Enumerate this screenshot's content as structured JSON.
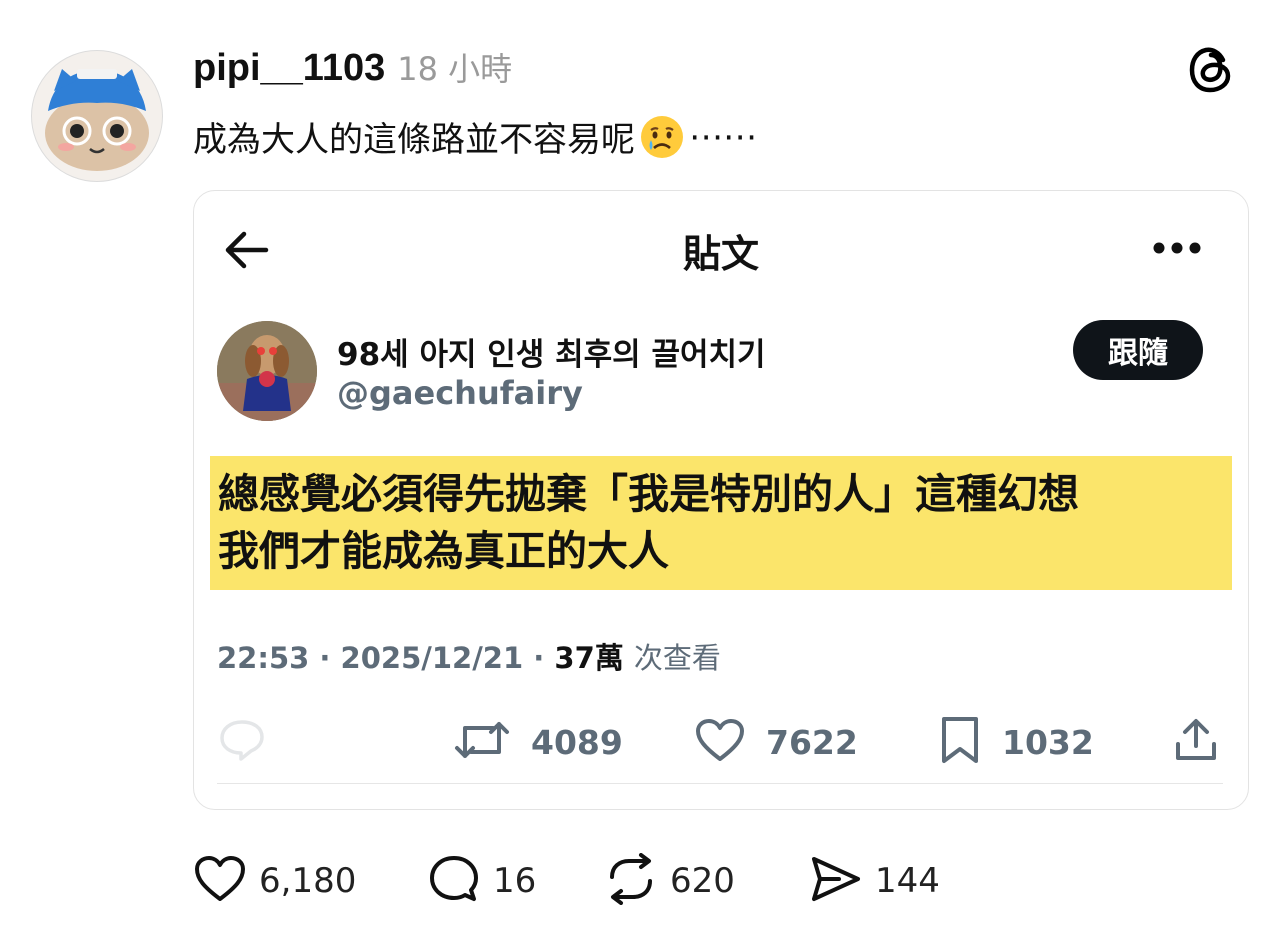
{
  "post": {
    "username": "pipi__1103",
    "time": "18 小時",
    "caption_before": "成為大人的這條路並不容易呢",
    "caption_after": "⋯⋯",
    "emoji": "crying-face",
    "app_icon": "threads-icon"
  },
  "embedded": {
    "title": "貼文",
    "name": "98세 아지 인생 최후의 끌어치기",
    "handle": "@gaechufairy",
    "follow_label": "跟隨",
    "text_line1": "總感覺必須得先拋棄「我是特別的人」這種幻想",
    "text_line2": "我們才能成為真正的大人",
    "highlight_color": "#fbe56b",
    "time": "22:53",
    "date": "2025/12/21",
    "views": "37萬",
    "views_label": "次查看",
    "retweets": "4089",
    "likes": "7622",
    "bookmarks": "1032"
  },
  "actions": {
    "likes": "6,180",
    "comments": "16",
    "reposts": "620",
    "shares": "144"
  }
}
